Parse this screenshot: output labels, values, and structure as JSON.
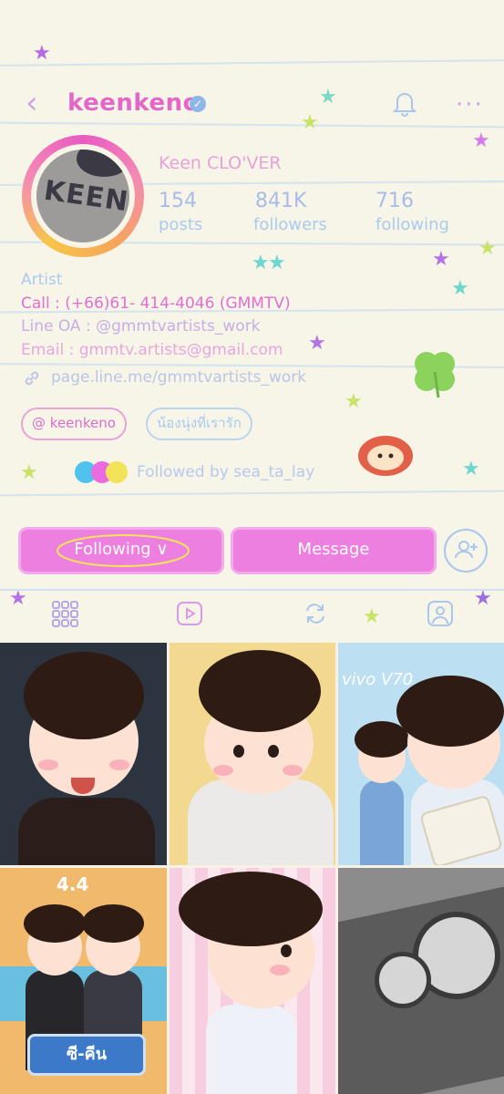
{
  "header": {
    "back_icon": "chevron-left-icon",
    "username": "keenkeno",
    "verified_icon": "verified-badge-icon",
    "bell_icon": "bell-icon",
    "more_icon": "more-horizontal-icon",
    "more_text": "···"
  },
  "profile": {
    "avatar_text": "KEEN",
    "display_name": "Keen CLO'VER",
    "stats": [
      {
        "value": "154",
        "label": "posts"
      },
      {
        "value": "841K",
        "label": "followers"
      },
      {
        "value": "716",
        "label": "following"
      }
    ]
  },
  "bio": {
    "category": "Artist",
    "call": "Call : (+66)61- 414-4046 (GMMTV)",
    "line_oa": "Line OA : @gmmtvartists_work",
    "email": "Email : gmmtv.artists@gmail.com",
    "link": "page.line.me/gmmtvartists_work"
  },
  "chips": [
    {
      "label": "@ keenkeno"
    },
    {
      "label": "น้องนุ่งที่เรารัก"
    }
  ],
  "followed_by": "Followed by sea_ta_lay",
  "actions": {
    "following_label": "Following ∨",
    "message_label": "Message"
  },
  "tabs": [
    "grid-icon",
    "reels-icon",
    "repost-icon",
    "tagged-icon"
  ],
  "posts": [
    {
      "caption": ""
    },
    {
      "caption": ""
    },
    {
      "caption": "vivo V70"
    },
    {
      "caption": "4.4"
    },
    {
      "caption": ""
    },
    {
      "caption": "ซี-คีน"
    }
  ],
  "colors": {
    "accent_pink": "#ec7fe0",
    "username_pink": "#e466c9",
    "stat_blue": "#a9bbe8",
    "paper": "#f7f4e8"
  }
}
